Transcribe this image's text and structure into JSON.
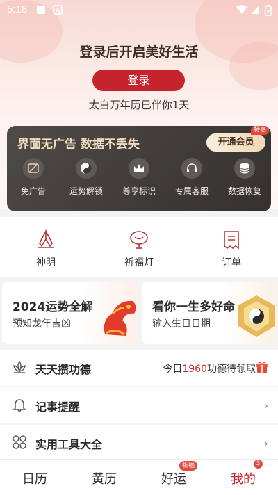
{
  "status": {
    "time": "5:18"
  },
  "login": {
    "title": "登录后开启美好生活",
    "button": "登录",
    "accompany": "太白万年历已伴你1天"
  },
  "vip": {
    "title": "界面无广告 数据不丢失",
    "button": "开通会员",
    "tag": "特惠",
    "perks": [
      {
        "label": "免广告",
        "icon": "no-ads-icon"
      },
      {
        "label": "运势解锁",
        "icon": "yin-yang-icon"
      },
      {
        "label": "尊享标识",
        "icon": "crown-icon"
      },
      {
        "label": "专属客服",
        "icon": "headset-icon"
      },
      {
        "label": "数据恢复",
        "icon": "database-icon"
      }
    ]
  },
  "quick": [
    {
      "label": "神明",
      "icon": "praying-hands-icon"
    },
    {
      "label": "祈福灯",
      "icon": "lamp-icon"
    },
    {
      "label": "订单",
      "icon": "receipt-icon"
    }
  ],
  "cards": {
    "left": {
      "title": "2024运势全解",
      "subtitle": "预知龙年吉凶"
    },
    "right": {
      "title": "看你一生多好命",
      "subtitle": "输入生日日期"
    }
  },
  "rows": {
    "merit": {
      "label": "天天攒功德",
      "extra_prefix": "今日",
      "extra_num": "1960",
      "extra_suffix": "功德待领取"
    },
    "reminder": {
      "label": "记事提醒"
    },
    "tools": {
      "label": "实用工具大全"
    }
  },
  "tabs": [
    {
      "label": "日历"
    },
    {
      "label": "黄历"
    },
    {
      "label": "好运",
      "badge": "祈福"
    },
    {
      "label": "我的",
      "badge": "3"
    }
  ],
  "colors": {
    "accent": "#c6242c",
    "vip_gold": "#f3dcc0"
  }
}
